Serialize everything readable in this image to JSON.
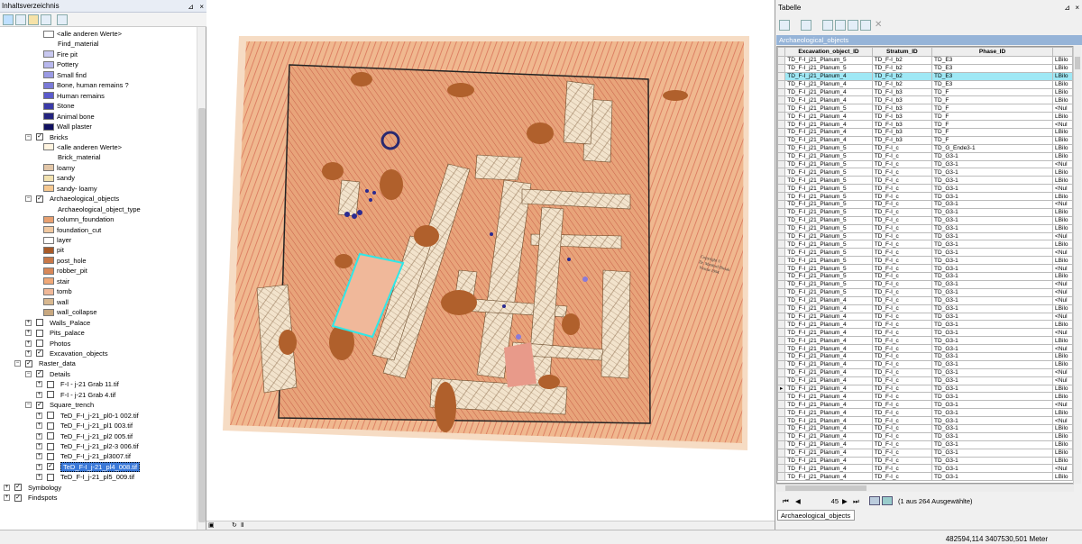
{
  "toc": {
    "title": "Inhaltsverzeichnis",
    "pin_icon": "pin-icon",
    "close_icon": "close-icon",
    "items": [
      {
        "label": "<alle anderen Werte>",
        "indent": 48,
        "type": "legend",
        "color": "#ffffff"
      },
      {
        "label": "Find_material",
        "indent": 64,
        "type": "header"
      },
      {
        "label": "Fire pit",
        "indent": 48,
        "type": "legend",
        "color": "#c8c8f0"
      },
      {
        "label": "Pottery",
        "indent": 48,
        "type": "legend",
        "color": "#b8b8ee"
      },
      {
        "label": "Small find",
        "indent": 48,
        "type": "legend",
        "color": "#9a9ae4"
      },
      {
        "label": "Bone, human remains ?",
        "indent": 48,
        "type": "legend",
        "color": "#7a7ad8"
      },
      {
        "label": "Human remains",
        "indent": 48,
        "type": "legend",
        "color": "#5a5acc"
      },
      {
        "label": "Stone",
        "indent": 48,
        "type": "legend",
        "color": "#3a3aa8"
      },
      {
        "label": "Animal bone",
        "indent": 48,
        "type": "legend",
        "color": "#23237f"
      },
      {
        "label": "Wall plaster",
        "indent": 48,
        "type": "legend",
        "color": "#101060"
      },
      {
        "label": "Bricks",
        "indent": 40,
        "type": "layer",
        "expanded": true,
        "checked": true
      },
      {
        "label": "<alle anderen Werte>",
        "indent": 48,
        "type": "legend",
        "color": "#fff4e0"
      },
      {
        "label": "Brick_material",
        "indent": 64,
        "type": "header"
      },
      {
        "label": "loamy",
        "indent": 48,
        "type": "legend",
        "color": "#e2c6a8"
      },
      {
        "label": "sandy",
        "indent": 48,
        "type": "legend",
        "color": "#f2e2b0"
      },
      {
        "label": "sandy- loamy",
        "indent": 48,
        "type": "legend",
        "color": "#f6c890"
      },
      {
        "label": "Archaeological_objects",
        "indent": 40,
        "type": "layer",
        "expanded": true,
        "checked": true
      },
      {
        "label": "Archaeological_object_type",
        "indent": 64,
        "type": "header"
      },
      {
        "label": "column_foundation",
        "indent": 48,
        "type": "legend",
        "color": "#e8a070"
      },
      {
        "label": "foundation_cut",
        "indent": 48,
        "type": "legend",
        "color": "#f0c8a0"
      },
      {
        "label": "layer",
        "indent": 48,
        "type": "legend",
        "color": "#ffffff"
      },
      {
        "label": "pit",
        "indent": 48,
        "type": "legend",
        "color": "#a85a28"
      },
      {
        "label": "post_hole",
        "indent": 48,
        "type": "legend",
        "color": "#c87848"
      },
      {
        "label": "robber_pit",
        "indent": 48,
        "type": "legend",
        "color": "#d88858"
      },
      {
        "label": "stair",
        "indent": 48,
        "type": "legend",
        "color": "#f0a878"
      },
      {
        "label": "tomb",
        "indent": 48,
        "type": "legend",
        "color": "#f0b898"
      },
      {
        "label": "wall",
        "indent": 48,
        "type": "legend",
        "color": "#d8b890"
      },
      {
        "label": "wall_collapse",
        "indent": 48,
        "type": "legend",
        "color": "#c8a880"
      },
      {
        "label": "Walls_Palace",
        "indent": 40,
        "type": "layer",
        "expanded": false,
        "checked": false
      },
      {
        "label": "Pits_palace",
        "indent": 40,
        "type": "layer",
        "expanded": false,
        "checked": false
      },
      {
        "label": "Photos",
        "indent": 40,
        "type": "layer",
        "expanded": false,
        "checked": false
      },
      {
        "label": "Excavation_objects",
        "indent": 40,
        "type": "layer",
        "expanded": false,
        "checked": true
      },
      {
        "label": "Raster_data",
        "indent": 28,
        "type": "group",
        "expanded": true,
        "checked": true
      },
      {
        "label": "Details",
        "indent": 40,
        "type": "layer",
        "expanded": true,
        "checked": true
      },
      {
        "label": "F-I - j-21 Grab 11.tif",
        "indent": 52,
        "type": "layer",
        "expanded": false,
        "checked": false
      },
      {
        "label": "F-I - j-21 Grab 4.tif",
        "indent": 52,
        "type": "layer",
        "expanded": false,
        "checked": false
      },
      {
        "label": "Square_trench",
        "indent": 40,
        "type": "layer",
        "expanded": true,
        "checked": true
      },
      {
        "label": "TeD_F-I_j-21_pl0-1  002.tif",
        "indent": 52,
        "type": "layer",
        "expanded": false,
        "checked": false
      },
      {
        "label": "TeD_F-I_j-21_pl1  003.tif",
        "indent": 52,
        "type": "layer",
        "expanded": false,
        "checked": false
      },
      {
        "label": "TeD_F-I_j-21_pl2 005.tif",
        "indent": 52,
        "type": "layer",
        "expanded": false,
        "checked": false
      },
      {
        "label": "TeD_F-I_j-21_pl2-3 006.tif",
        "indent": 52,
        "type": "layer",
        "expanded": false,
        "checked": false
      },
      {
        "label": "TeD_F-I_j-21_pl3007.tif",
        "indent": 52,
        "type": "layer",
        "expanded": false,
        "checked": false
      },
      {
        "label": "TeD_F-I_j-21_pl4_008.tif",
        "indent": 52,
        "type": "layer",
        "expanded": false,
        "checked": true,
        "selected": true
      },
      {
        "label": "TeD_F-I_j-21_pl5_009.tif",
        "indent": 52,
        "type": "layer",
        "expanded": false,
        "checked": false
      },
      {
        "label": "Symbology",
        "indent": 16,
        "type": "group",
        "expanded": false,
        "checked": true
      },
      {
        "label": "Findspots",
        "indent": 16,
        "type": "group",
        "expanded": false,
        "checked": true
      }
    ]
  },
  "map": {
    "copyright_text": "Copyright ©\nDr. Manfred Bietak\nVienna 1994",
    "toolbar_icons": [
      "page-layout-icon",
      "refresh-icon",
      "pause-icon"
    ]
  },
  "table": {
    "title": "Tabelle",
    "layer_name": "Archaeological_objects",
    "columns": [
      "Excavation_object_ID",
      "Stratum_ID",
      "Phase_ID",
      ""
    ],
    "rows": [
      [
        "TD_F-I_j21_Planum_5",
        "TD_F-I_b2",
        "TD_E3",
        "LBilo"
      ],
      [
        "TD_F-I_j21_Planum_5",
        "TD_F-I_b2",
        "TD_E3",
        "LBilo"
      ],
      [
        "TD_F-I_j21_Planum_4",
        "TD_F-I_b2",
        "TD_E3",
        "LBilo"
      ],
      [
        "TD_F-I_j21_Planum_4",
        "TD_F-I_b2",
        "TD_E3",
        "LBilo"
      ],
      [
        "TD_F-I_j21_Planum_4",
        "TD_F-I_b3",
        "TD_F",
        "LBilo"
      ],
      [
        "TD_F-I_j21_Planum_4",
        "TD_F-I_b3",
        "TD_F",
        "LBilo"
      ],
      [
        "TD_F-I_j21_Planum_5",
        "TD_F-I_b3",
        "TD_F",
        "<Nul"
      ],
      [
        "TD_F-I_j21_Planum_4",
        "TD_F-I_b3",
        "TD_F",
        "LBilo"
      ],
      [
        "TD_F-I_j21_Planum_4",
        "TD_F-I_b3",
        "TD_F",
        "<Nul"
      ],
      [
        "TD_F-I_j21_Planum_4",
        "TD_F-I_b3",
        "TD_F",
        "LBilo"
      ],
      [
        "TD_F-I_j21_Planum_4",
        "TD_F-I_b3",
        "TD_F",
        "LBilo"
      ],
      [
        "TD_F-I_j21_Planum_5",
        "TD_F-I_c",
        "TD_G_Ende3-1",
        "LBilo"
      ],
      [
        "TD_F-I_j21_Planum_5",
        "TD_F-I_c",
        "TD_G3-1",
        "LBilo"
      ],
      [
        "TD_F-I_j21_Planum_5",
        "TD_F-I_c",
        "TD_G3-1",
        "<Nul"
      ],
      [
        "TD_F-I_j21_Planum_5",
        "TD_F-I_c",
        "TD_G3-1",
        "LBilo"
      ],
      [
        "TD_F-I_j21_Planum_5",
        "TD_F-I_c",
        "TD_G3-1",
        "LBilo"
      ],
      [
        "TD_F-I_j21_Planum_5",
        "TD_F-I_c",
        "TD_G3-1",
        "<Nul"
      ],
      [
        "TD_F-I_j21_Planum_5",
        "TD_F-I_c",
        "TD_G3-1",
        "LBilo"
      ],
      [
        "TD_F-I_j21_Planum_5",
        "TD_F-I_c",
        "TD_G3-1",
        "<Nul"
      ],
      [
        "TD_F-I_j21_Planum_5",
        "TD_F-I_c",
        "TD_G3-1",
        "LBilo"
      ],
      [
        "TD_F-I_j21_Planum_5",
        "TD_F-I_c",
        "TD_G3-1",
        "LBilo"
      ],
      [
        "TD_F-I_j21_Planum_5",
        "TD_F-I_c",
        "TD_G3-1",
        "LBilo"
      ],
      [
        "TD_F-I_j21_Planum_5",
        "TD_F-I_c",
        "TD_G3-1",
        "<Nul"
      ],
      [
        "TD_F-I_j21_Planum_5",
        "TD_F-I_c",
        "TD_G3-1",
        "LBilo"
      ],
      [
        "TD_F-I_j21_Planum_5",
        "TD_F-I_c",
        "TD_G3-1",
        "<Nul"
      ],
      [
        "TD_F-I_j21_Planum_5",
        "TD_F-I_c",
        "TD_G3-1",
        "LBilo"
      ],
      [
        "TD_F-I_j21_Planum_5",
        "TD_F-I_c",
        "TD_G3-1",
        "<Nul"
      ],
      [
        "TD_F-I_j21_Planum_5",
        "TD_F-I_c",
        "TD_G3-1",
        "LBilo"
      ],
      [
        "TD_F-I_j21_Planum_5",
        "TD_F-I_c",
        "TD_G3-1",
        "<Nul"
      ],
      [
        "TD_F-I_j21_Planum_5",
        "TD_F-I_c",
        "TD_G3-1",
        "<Nul"
      ],
      [
        "TD_F-I_j21_Planum_4",
        "TD_F-I_c",
        "TD_G3-1",
        "<Nul"
      ],
      [
        "TD_F-I_j21_Planum_4",
        "TD_F-I_c",
        "TD_G3-1",
        "LBilo"
      ],
      [
        "TD_F-I_j21_Planum_4",
        "TD_F-I_c",
        "TD_G3-1",
        "<Nul"
      ],
      [
        "TD_F-I_j21_Planum_4",
        "TD_F-I_c",
        "TD_G3-1",
        "LBilo"
      ],
      [
        "TD_F-I_j21_Planum_4",
        "TD_F-I_c",
        "TD_G3-1",
        "<Nul"
      ],
      [
        "TD_F-I_j21_Planum_4",
        "TD_F-I_c",
        "TD_G3-1",
        "LBilo"
      ],
      [
        "TD_F-I_j21_Planum_4",
        "TD_F-I_c",
        "TD_G3-1",
        "<Nul"
      ],
      [
        "TD_F-I_j21_Planum_4",
        "TD_F-I_c",
        "TD_G3-1",
        "LBilo"
      ],
      [
        "TD_F-I_j21_Planum_4",
        "TD_F-I_c",
        "TD_G3-1",
        "LBilo"
      ],
      [
        "TD_F-I_j21_Planum_4",
        "TD_F-I_c",
        "TD_G3-1",
        "<Nul"
      ],
      [
        "TD_F-I_j21_Planum_4",
        "TD_F-I_c",
        "TD_G3-1",
        "<Nul"
      ],
      [
        "TD_F-I_j21_Planum_4",
        "TD_F-I_c",
        "TD_G3-1",
        "LBilo"
      ],
      [
        "TD_F-I_j21_Planum_4",
        "TD_F-I_c",
        "TD_G3-1",
        "LBilo"
      ],
      [
        "TD_F-I_j21_Planum_4",
        "TD_F-I_c",
        "TD_G3-1",
        "<Nul"
      ],
      [
        "TD_F-I_j21_Planum_4",
        "TD_F-I_c",
        "TD_G3-1",
        "LBilo"
      ],
      [
        "TD_F-I_j21_Planum_4",
        "TD_F-I_c",
        "TD_G3-1",
        "<Nul"
      ],
      [
        "TD_F-I_j21_Planum_4",
        "TD_F-I_c",
        "TD_G3-1",
        "LBilo"
      ],
      [
        "TD_F-I_j21_Planum_4",
        "TD_F-I_c",
        "TD_G3-1",
        "LBilo"
      ],
      [
        "TD_F-I_j21_Planum_4",
        "TD_F-I_c",
        "TD_G3-1",
        "LBilo"
      ],
      [
        "TD_F-I_j21_Planum_4",
        "TD_F-I_c",
        "TD_G3-1",
        "LBilo"
      ],
      [
        "TD_F-I_j21_Planum_4",
        "TD_F-I_c",
        "TD_G3-1",
        "LBilo"
      ],
      [
        "TD_F-I_j21_Planum_4",
        "TD_F-I_c",
        "TD_G3-1",
        "<Nul"
      ],
      [
        "TD_F-I_j21_Planum_4",
        "TD_F-I_c",
        "TD_G3-1",
        "LBilo"
      ]
    ],
    "selected_row_index": 2,
    "pointer_row_index": 41,
    "nav": {
      "record": "45",
      "status": "(1 aus 264 Ausgewählte)"
    },
    "bottom_tab": "Archaeological_objects"
  },
  "status": {
    "coordinates": "482594,114  3407530,501 Meter"
  }
}
